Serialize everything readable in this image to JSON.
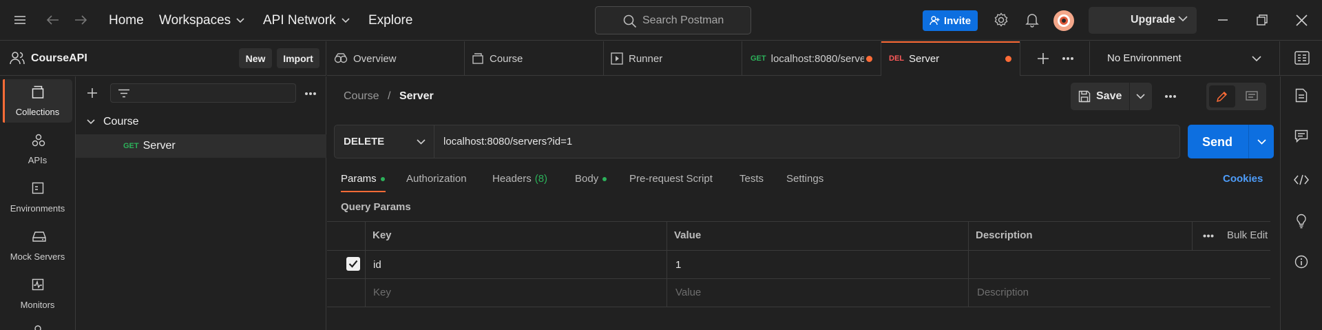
{
  "topbar": {
    "nav": {
      "home": "Home",
      "workspaces": "Workspaces",
      "api_network": "API Network",
      "explore": "Explore"
    },
    "search_placeholder": "Search Postman",
    "invite_label": "Invite",
    "upgrade_label": "Upgrade"
  },
  "workspace": {
    "name": "CourseAPI",
    "new_label": "New",
    "import_label": "Import"
  },
  "tabs": [
    {
      "label": "Overview"
    },
    {
      "label": "Course"
    },
    {
      "label": "Runner"
    },
    {
      "method": "GET",
      "label": "localhost:8080/serve"
    },
    {
      "method": "DEL",
      "label": "Server"
    }
  ],
  "environment": "No Environment",
  "rail": [
    {
      "label": "Collections",
      "icon": "collections-icon"
    },
    {
      "label": "APIs",
      "icon": "apis-icon"
    },
    {
      "label": "Environments",
      "icon": "environments-icon"
    },
    {
      "label": "Mock Servers",
      "icon": "mock-servers-icon"
    },
    {
      "label": "Monitors",
      "icon": "monitors-icon"
    }
  ],
  "sidebar": {
    "collection": "Course",
    "request_method": "GET",
    "request_name": "Server"
  },
  "request": {
    "breadcrumb_parent": "Course",
    "breadcrumb_sep": "/",
    "breadcrumb_current": "Server",
    "save_label": "Save",
    "method": "DELETE",
    "url": "localhost:8080/servers?id=1",
    "send_label": "Send"
  },
  "request_tabs": {
    "params": "Params",
    "authorization": "Authorization",
    "headers": "Headers",
    "headers_count": "(8)",
    "body": "Body",
    "prerequest": "Pre-request Script",
    "tests": "Tests",
    "settings": "Settings",
    "cookies": "Cookies"
  },
  "query_params": {
    "title": "Query Params",
    "headers": {
      "key": "Key",
      "value": "Value",
      "description": "Description",
      "bulk_edit": "Bulk Edit"
    },
    "rows": [
      {
        "checked": true,
        "key": "id",
        "value": "1",
        "description": ""
      }
    ],
    "placeholders": {
      "key": "Key",
      "value": "Value",
      "description": "Description"
    }
  },
  "colors": {
    "accent_orange": "#ff6c37",
    "primary_blue": "#0d6fe0",
    "get_green": "#2cb15a",
    "del_red": "#ff5a5a"
  }
}
